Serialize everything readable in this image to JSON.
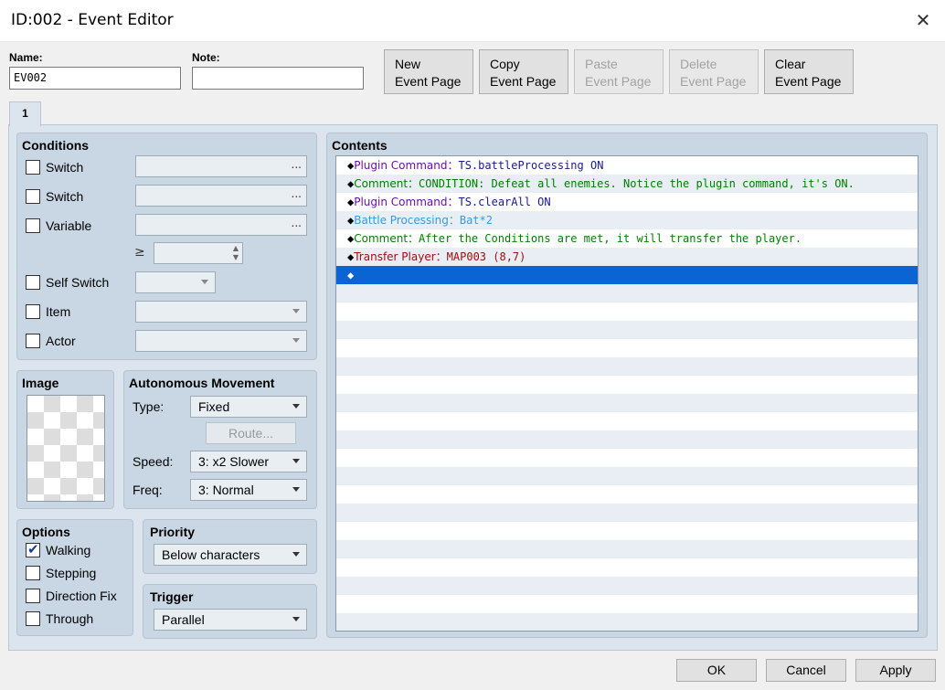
{
  "window": {
    "title": "ID:002 - Event Editor"
  },
  "header": {
    "name_label": "Name:",
    "name_value": "EV002",
    "note_label": "Note:",
    "note_value": "",
    "buttons": [
      {
        "label": "New\nEvent Page",
        "enabled": true
      },
      {
        "label": "Copy\nEvent Page",
        "enabled": true
      },
      {
        "label": "Paste\nEvent Page",
        "enabled": false
      },
      {
        "label": "Delete\nEvent Page",
        "enabled": false
      },
      {
        "label": "Clear\nEvent Page",
        "enabled": true
      }
    ]
  },
  "tabs": [
    {
      "label": "1"
    }
  ],
  "conditions": {
    "title": "Conditions",
    "switch1": "Switch",
    "switch2": "Switch",
    "variable": "Variable",
    "gte": "≥",
    "self_switch": "Self Switch",
    "item": "Item",
    "actor": "Actor",
    "ellipsis": "..."
  },
  "image": {
    "title": "Image"
  },
  "movement": {
    "title": "Autonomous Movement",
    "type_label": "Type:",
    "type_value": "Fixed",
    "route_label": "Route...",
    "speed_label": "Speed:",
    "speed_value": "3: x2 Slower",
    "freq_label": "Freq:",
    "freq_value": "3: Normal"
  },
  "options": {
    "title": "Options",
    "items": [
      {
        "label": "Walking",
        "checked": true
      },
      {
        "label": "Stepping",
        "checked": false
      },
      {
        "label": "Direction Fix",
        "checked": false
      },
      {
        "label": "Through",
        "checked": false
      }
    ]
  },
  "priority": {
    "title": "Priority",
    "value": "Below characters"
  },
  "trigger": {
    "title": "Trigger",
    "value": "Parallel"
  },
  "contents": {
    "title": "Contents",
    "diamond": "◆",
    "empty_diamond": "◆",
    "rows": [
      {
        "cmd": "Plugin Command",
        "sep": "：",
        "arg": "TS.battleProcessing ON",
        "cmd_color": "#6a0dad",
        "arg_color": "#1a1a8c"
      },
      {
        "cmd": "Comment",
        "sep": "：",
        "arg": "CONDITION: Defeat all enemies. Notice the plugin command, it's ON.",
        "cmd_color": "#008000",
        "arg_color": "#008000"
      },
      {
        "cmd": "Plugin Command",
        "sep": "：",
        "arg": "TS.clearAll ON",
        "cmd_color": "#6a0dad",
        "arg_color": "#1a1a8c"
      },
      {
        "cmd": "Battle Processing",
        "sep": "：",
        "arg": "Bat*2",
        "cmd_color": "#3a9ad9",
        "arg_color": "#3a9ad9"
      },
      {
        "cmd": "Comment",
        "sep": "：",
        "arg": "After the Conditions are met, it will transfer the player.",
        "cmd_color": "#008000",
        "arg_color": "#008000"
      },
      {
        "cmd": "Transfer Player",
        "sep": "：",
        "arg": "MAP003 (8,7)",
        "cmd_color": "#a01010",
        "arg_color": "#a01010"
      }
    ],
    "selected_color": "#0a64d2"
  },
  "footer": {
    "ok": "OK",
    "cancel": "Cancel",
    "apply": "Apply"
  }
}
